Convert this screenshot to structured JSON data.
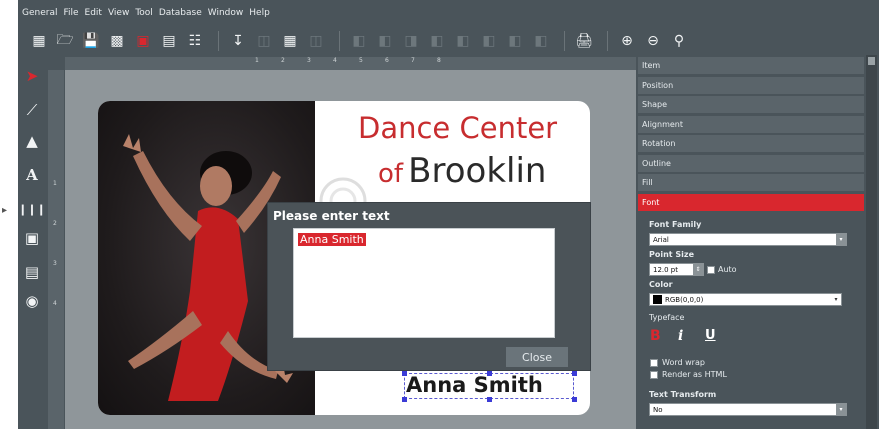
{
  "menu": [
    "General",
    "File",
    "Edit",
    "View",
    "Tool",
    "Database",
    "Window",
    "Help"
  ],
  "toolbar": {
    "icons": [
      "new-icon",
      "open-icon",
      "save-icon",
      "save-as-icon",
      "record-icon",
      "preview-icon",
      "properties-icon",
      "import-icon",
      "grid-icon",
      "layout-icon",
      "align-icon",
      "print-icon",
      "zoom-in-icon",
      "zoom-out-icon",
      "zoom-fit-icon"
    ]
  },
  "tools": [
    "pointer-icon",
    "line-icon",
    "shapes-icon",
    "text-icon",
    "barcode-icon",
    "qrcode-icon",
    "image-icon",
    "camera-icon"
  ],
  "ruler": {
    "h_numbers": [
      "1",
      "2",
      "3",
      "4",
      "5",
      "6",
      "7",
      "8"
    ],
    "v_numbers": [
      "1",
      "2",
      "3",
      "4"
    ]
  },
  "card": {
    "title_line1": "Dance Center",
    "title_line2_prefix": "of",
    "title_line2_main": "Brooklin",
    "name": "Anna Smith"
  },
  "dialog": {
    "title": "Please enter text",
    "text": "Anna Smith",
    "close_label": "Close"
  },
  "inspector": {
    "sections": [
      "Item",
      "Position",
      "Shape",
      "Alignment",
      "Rotation",
      "Outline",
      "Fill",
      "Font"
    ],
    "active_section": "Font",
    "font_family_label": "Font Family",
    "font_family_value": "Arial",
    "point_size_label": "Point Size",
    "point_size_value": "12.0 pt",
    "auto_label": "Auto",
    "color_label": "Color",
    "color_value": "RGB(0,0,0)",
    "typeface_label": "Typeface",
    "word_wrap_label": "Word wrap",
    "render_html_label": "Render as HTML",
    "text_transform_label": "Text Transform",
    "text_transform_value": "No"
  },
  "colors": {
    "accent": "#d9272e",
    "panel": "#4a545a",
    "canvas": "#8f969a"
  }
}
